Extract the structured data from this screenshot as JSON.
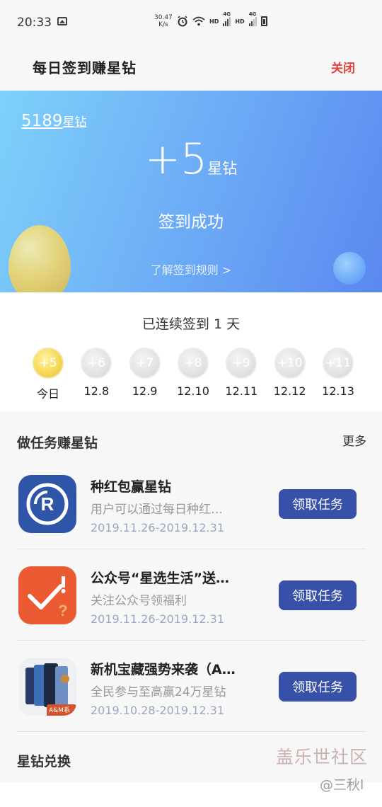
{
  "status_bar": {
    "time": "20:33",
    "speed_value": "30.47",
    "speed_unit": "K/s",
    "net1": "HD",
    "net1_type": "4G",
    "net2": "HD",
    "net2_type": "4G"
  },
  "header": {
    "title": "每日签到赚星钻",
    "close_label": "关闭"
  },
  "banner": {
    "balance_value": "5189",
    "balance_unit": "星钻",
    "gain_value": "+5",
    "gain_unit": "星钻",
    "status_text": "签到成功",
    "rules_link": "了解签到规则 >"
  },
  "streak": {
    "text": "已连续签到 1 天",
    "days": [
      {
        "reward": "+5",
        "label": "今日",
        "active": true
      },
      {
        "reward": "+6",
        "label": "12.8",
        "active": false
      },
      {
        "reward": "+7",
        "label": "12.9",
        "active": false
      },
      {
        "reward": "+8",
        "label": "12.10",
        "active": false
      },
      {
        "reward": "+9",
        "label": "12.11",
        "active": false
      },
      {
        "reward": "+10",
        "label": "12.12",
        "active": false
      },
      {
        "reward": "+11",
        "label": "12.13",
        "active": false
      }
    ]
  },
  "tasks": {
    "title": "做任务赚星钻",
    "more_label": "更多",
    "items": [
      {
        "name": "种红包赢星钻",
        "desc": "用户可以通过每日种红…",
        "date": "2019.11.26-2019.12.31",
        "button": "领取任务",
        "icon": "samsung-rewards-icon"
      },
      {
        "name": "公众号“星选生活”送…",
        "desc": "关注公众号领福利",
        "date": "2019.11.26-2019.12.31",
        "button": "领取任务",
        "icon": "check-exclamation-icon"
      },
      {
        "name": "新机宝藏强势来袭（A…",
        "desc": "全民参与至高赢24万星钻",
        "date": "2019.10.28-2019.12.31",
        "button": "领取任务",
        "icon": "phones-icon",
        "icon_badge": "A&M系列"
      }
    ]
  },
  "exchange": {
    "title": "星钻兑换"
  },
  "watermark": {
    "community": "盖乐世社区",
    "user": "@三秋l"
  },
  "colors": {
    "accent_button": "#3751a8",
    "close_red": "#e0443a",
    "coin_gold": "#f5d957",
    "banner_blue": "#6fb0f6"
  }
}
